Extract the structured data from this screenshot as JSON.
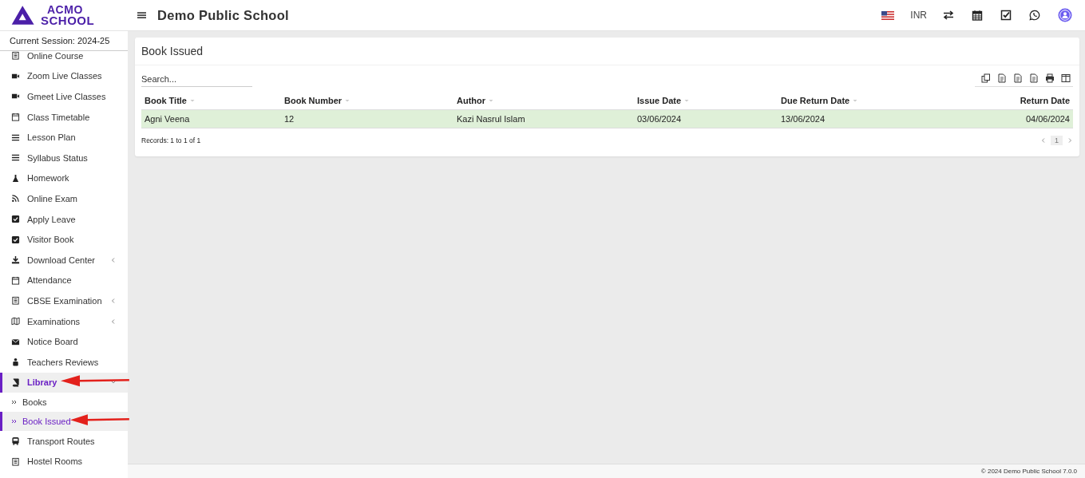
{
  "header": {
    "brand": [
      "ACMO",
      "SCHOOL"
    ],
    "school_name": "Demo Public School",
    "currency": "INR"
  },
  "sidebar": {
    "session": "Current Session: 2024-25",
    "items": [
      {
        "label": "Online Course",
        "submenu": false,
        "selected": false
      },
      {
        "label": "Zoom Live Classes",
        "submenu": false,
        "selected": false
      },
      {
        "label": "Gmeet Live Classes",
        "submenu": false,
        "selected": false
      },
      {
        "label": "Class Timetable",
        "submenu": false,
        "selected": false
      },
      {
        "label": "Lesson Plan",
        "submenu": false,
        "selected": false
      },
      {
        "label": "Syllabus Status",
        "submenu": false,
        "selected": false
      },
      {
        "label": "Homework",
        "submenu": false,
        "selected": false
      },
      {
        "label": "Online Exam",
        "submenu": false,
        "selected": false
      },
      {
        "label": "Apply Leave",
        "submenu": false,
        "selected": false
      },
      {
        "label": "Visitor Book",
        "submenu": false,
        "selected": false
      },
      {
        "label": "Download Center",
        "submenu": true,
        "selected": false
      },
      {
        "label": "Attendance",
        "submenu": false,
        "selected": false
      },
      {
        "label": "CBSE Examination",
        "submenu": true,
        "selected": false
      },
      {
        "label": "Examinations",
        "submenu": true,
        "selected": false
      },
      {
        "label": "Notice Board",
        "submenu": false,
        "selected": false
      },
      {
        "label": "Teachers Reviews",
        "submenu": false,
        "selected": false
      },
      {
        "label": "Library",
        "submenu": true,
        "selected": true,
        "expanded": true,
        "children": [
          {
            "label": "Books",
            "selected": false
          },
          {
            "label": "Book Issued",
            "selected": true
          }
        ]
      },
      {
        "label": "Transport Routes",
        "submenu": false,
        "selected": false
      },
      {
        "label": "Hostel Rooms",
        "submenu": false,
        "selected": false
      }
    ]
  },
  "panel": {
    "title": "Book Issued",
    "search": {
      "placeholder": "Search..."
    },
    "table": {
      "columns": [
        {
          "label": "Book Title",
          "sortable": true
        },
        {
          "label": "Book Number",
          "sortable": true
        },
        {
          "label": "Author",
          "sortable": true
        },
        {
          "label": "Issue Date",
          "sortable": true
        },
        {
          "label": "Due Return Date",
          "sortable": true
        },
        {
          "label": "Return Date",
          "sortable": false
        }
      ],
      "rows": [
        {
          "selected": true,
          "cells": [
            "Agni Veena",
            "12",
            "Kazi Nasrul Islam",
            "03/06/2024",
            "13/06/2024",
            "04/06/2024"
          ]
        }
      ]
    },
    "records": "Records: 1 to 1 of 1",
    "pages": [
      {
        "label": "1",
        "selected": true
      }
    ]
  },
  "footer": "© 2024 Demo Public School 7.0.0"
}
